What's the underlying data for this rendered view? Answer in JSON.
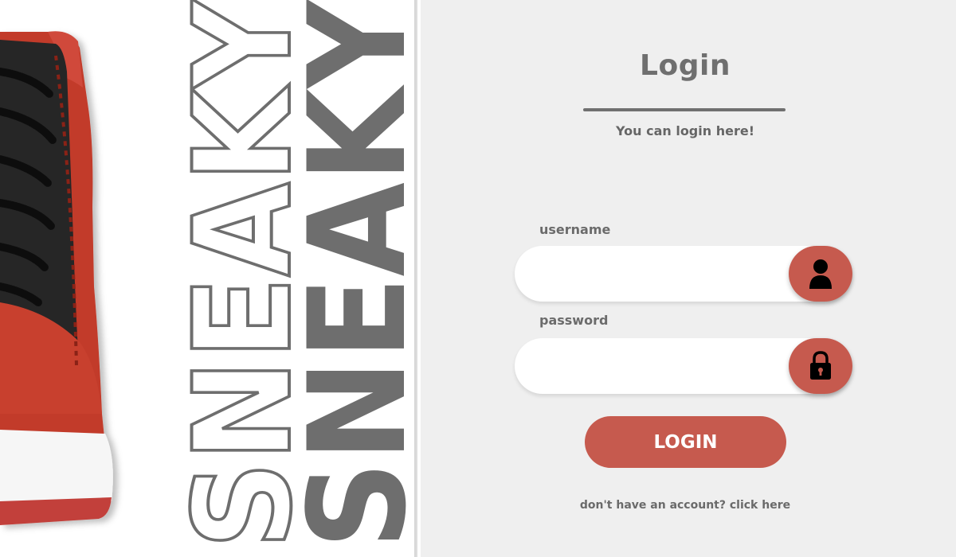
{
  "brand": {
    "wordmark_outline": "SNEAKY",
    "wordmark_solid": "SNEAKY"
  },
  "login": {
    "title": "Login",
    "subtitle": "You can login here!",
    "username_label": "username",
    "username_value": "",
    "password_label": "password",
    "password_value": "",
    "submit_label": "LOGIN",
    "signup_text": "don't have an account? click here"
  },
  "icons": {
    "username": "user-icon",
    "password": "lock-icon"
  },
  "colors": {
    "accent": "#c65a4e",
    "panel_background": "#efefef",
    "text": "#6f6f6f",
    "wordmark_solid": "#6e6e6e",
    "shoe_primary": "#c0392b",
    "shoe_mesh": "#2a2a2a",
    "shoe_sole": "#ffffff"
  }
}
